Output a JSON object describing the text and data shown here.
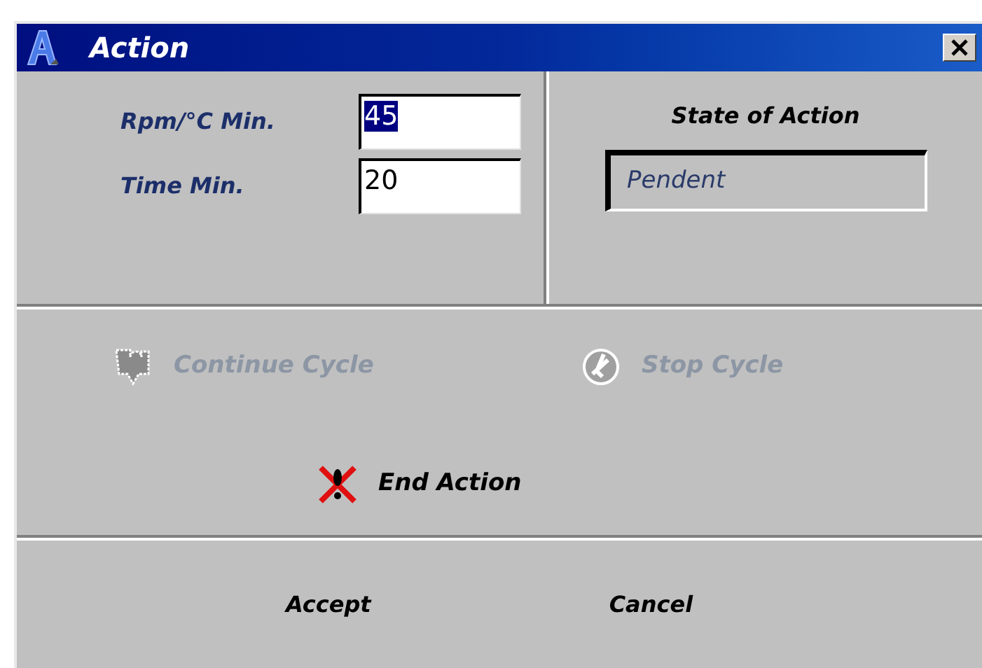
{
  "window": {
    "title": "Action"
  },
  "fields": [
    {
      "label": "Rpm/°C Min.",
      "value": "45",
      "selected": true
    },
    {
      "label": "Time Min.",
      "value": "20",
      "selected": false
    }
  ],
  "state": {
    "label": "State of Action",
    "value": "Pendent"
  },
  "actions": [
    {
      "kind": "continue",
      "label": "Continue Cycle",
      "disabled": true
    },
    {
      "kind": "stop",
      "label": "Stop Cycle",
      "disabled": true
    },
    {
      "kind": "end",
      "label": "End Action",
      "disabled": false
    }
  ],
  "buttons": [
    "Accept",
    "Cancel"
  ]
}
